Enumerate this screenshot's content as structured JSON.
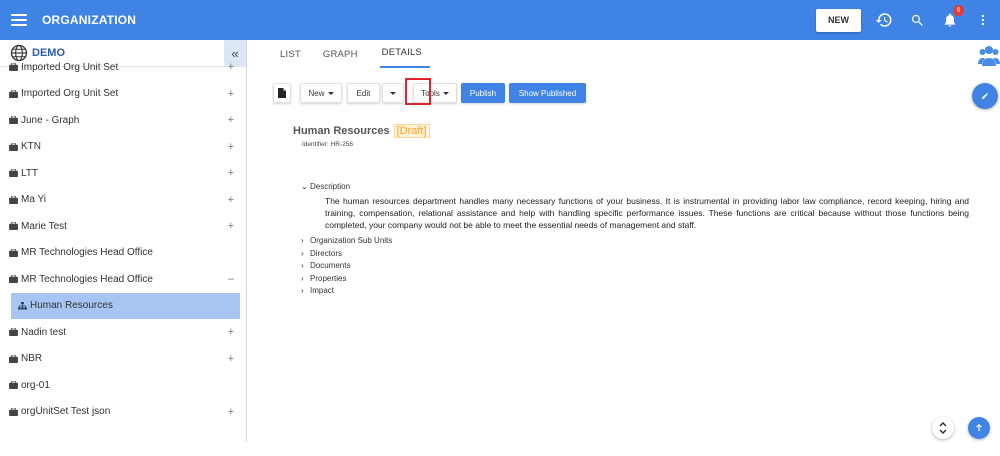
{
  "topbar": {
    "title": "ORGANIZATION",
    "new_label": "NEW",
    "notifications_count": "6"
  },
  "sidebar": {
    "root_label": "DEMO",
    "items": [
      {
        "label": "Imported Org Unit Set",
        "toggle": "+"
      },
      {
        "label": "Imported Org Unit Set",
        "toggle": "+"
      },
      {
        "label": "June - Graph",
        "toggle": "+"
      },
      {
        "label": "KTN",
        "toggle": "+"
      },
      {
        "label": "LTT",
        "toggle": "+"
      },
      {
        "label": "Ma Yi",
        "toggle": "+"
      },
      {
        "label": "Marie Test",
        "toggle": "+"
      },
      {
        "label": "MR Technologies Head Office",
        "toggle": ""
      },
      {
        "label": "MR Technologies Head Office",
        "toggle": "–"
      },
      {
        "label": "Human Resources",
        "toggle": "",
        "active": true
      },
      {
        "label": "Nadin test",
        "toggle": "+"
      },
      {
        "label": "NBR",
        "toggle": "+"
      },
      {
        "label": "org-01",
        "toggle": ""
      },
      {
        "label": "orgUnitSet Test json",
        "toggle": "+"
      }
    ]
  },
  "tabs": [
    {
      "label": "LIST"
    },
    {
      "label": "GRAPH"
    },
    {
      "label": "DETAILS",
      "active": true
    }
  ],
  "toolbar": {
    "new_label": "New",
    "edit_label": "Edit",
    "tools_label": "Tools",
    "publish_label": "Publish",
    "show_published_label": "Show Published"
  },
  "record": {
    "title": "Human Resources",
    "status": "[Draft]",
    "identifier": "Identifier:  HR-256"
  },
  "sections": {
    "description_label": "Description",
    "description_text": "The human resources department handles many necessary functions of your business. It is instrumental in providing labor law compliance, record keeping, hiring and training, compensation, relational assistance and help with handling specific performance issues. These functions are critical because without those functions being completed, your company would not be able to meet the essential needs of management and staff.",
    "collapsed": [
      "Organization Sub Units",
      "Directors",
      "Documents",
      "Properties",
      "Impact"
    ]
  },
  "colors": {
    "primary": "#3f84e5",
    "active_item": "#a7c5f2",
    "highlight": "#e0232a",
    "draft": "#f0a030"
  }
}
